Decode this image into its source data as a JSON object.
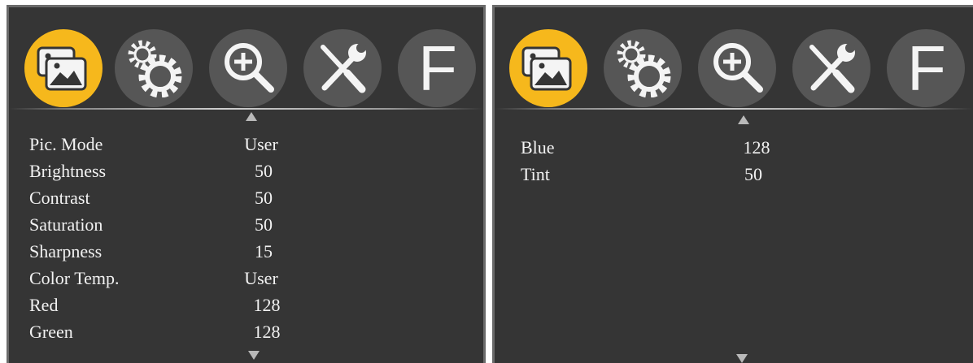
{
  "panels": [
    {
      "id": "left",
      "rows": [
        {
          "label": "Pic. Mode",
          "value": "User"
        },
        {
          "label": "Brightness",
          "value": "50"
        },
        {
          "label": "Contrast",
          "value": "50"
        },
        {
          "label": "Saturation",
          "value": "50"
        },
        {
          "label": "Sharpness",
          "value": "15"
        },
        {
          "label": "Color Temp.",
          "value": "User"
        },
        {
          "label": "Red",
          "value": "128"
        },
        {
          "label": "Green",
          "value": "128"
        }
      ]
    },
    {
      "id": "right",
      "rows": [
        {
          "label": "Blue",
          "value": "128"
        },
        {
          "label": "Tint",
          "value": "50"
        }
      ]
    }
  ],
  "tabs": [
    {
      "icon": "picture-icon",
      "active": true
    },
    {
      "icon": "gears-icon",
      "active": false
    },
    {
      "icon": "zoom-in-icon",
      "active": false
    },
    {
      "icon": "tools-icon",
      "active": false
    },
    {
      "icon": "f-letter-icon",
      "text": "F",
      "active": false
    }
  ],
  "colors": {
    "panel_bg": "#353535",
    "active_tab": "#f6b81c",
    "inactive_tab": "#565656",
    "text": "#f2f2f2"
  }
}
